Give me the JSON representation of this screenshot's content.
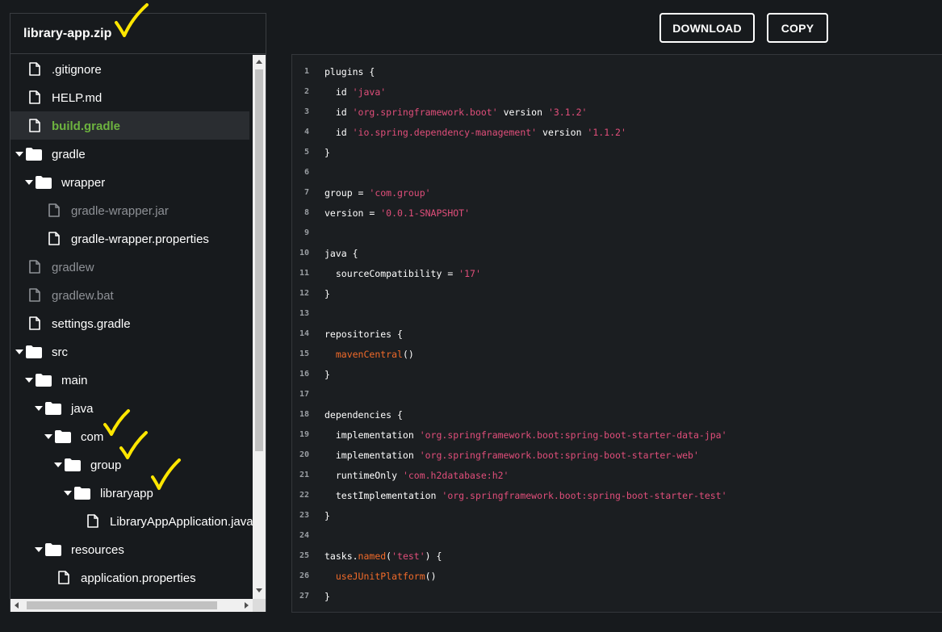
{
  "colors": {
    "background": "#171a1d",
    "selected_file": "#6db33f",
    "string_token": "#e04e7a",
    "function_token": "#f26b2a",
    "check_mark": "#ffe600",
    "dimmed_file": "#8e9196"
  },
  "tree": {
    "archive_name": "library-app.zip",
    "items": [
      {
        "label": ".gitignore",
        "kind": "file",
        "depth": 0,
        "dim": false,
        "selected": false
      },
      {
        "label": "HELP.md",
        "kind": "file",
        "depth": 0,
        "dim": false,
        "selected": false
      },
      {
        "label": "build.gradle",
        "kind": "file",
        "depth": 0,
        "dim": false,
        "selected": true
      },
      {
        "label": "gradle",
        "kind": "folder",
        "depth": 0,
        "dim": false,
        "selected": false
      },
      {
        "label": "wrapper",
        "kind": "folder",
        "depth": 1,
        "dim": false,
        "selected": false
      },
      {
        "label": "gradle-wrapper.jar",
        "kind": "file",
        "depth": 2,
        "dim": true,
        "selected": false
      },
      {
        "label": "gradle-wrapper.properties",
        "kind": "file",
        "depth": 2,
        "dim": false,
        "selected": false
      },
      {
        "label": "gradlew",
        "kind": "file",
        "depth": 0,
        "dim": true,
        "selected": false
      },
      {
        "label": "gradlew.bat",
        "kind": "file",
        "depth": 0,
        "dim": true,
        "selected": false
      },
      {
        "label": "settings.gradle",
        "kind": "file",
        "depth": 0,
        "dim": false,
        "selected": false
      },
      {
        "label": "src",
        "kind": "folder",
        "depth": 0,
        "dim": false,
        "selected": false
      },
      {
        "label": "main",
        "kind": "folder",
        "depth": 1,
        "dim": false,
        "selected": false
      },
      {
        "label": "java",
        "kind": "folder",
        "depth": 2,
        "dim": false,
        "selected": false
      },
      {
        "label": "com",
        "kind": "folder",
        "depth": 3,
        "dim": false,
        "selected": false
      },
      {
        "label": "group",
        "kind": "folder",
        "depth": 4,
        "dim": false,
        "selected": false
      },
      {
        "label": "libraryapp",
        "kind": "folder",
        "depth": 5,
        "dim": false,
        "selected": false
      },
      {
        "label": "LibraryAppApplication.java",
        "kind": "file",
        "depth": 6,
        "dim": false,
        "selected": false
      },
      {
        "label": "resources",
        "kind": "folder",
        "depth": 2,
        "dim": false,
        "selected": false
      },
      {
        "label": "application.properties",
        "kind": "file",
        "depth": 3,
        "dim": false,
        "selected": false
      }
    ]
  },
  "toolbar": {
    "download_label": "DOWNLOAD",
    "copy_label": "COPY"
  },
  "code": {
    "lines": [
      [
        [
          "plugins {",
          "plain"
        ]
      ],
      [
        [
          "  id ",
          "plain"
        ],
        [
          "'java'",
          "str"
        ]
      ],
      [
        [
          "  id ",
          "plain"
        ],
        [
          "'org.springframework.boot'",
          "str"
        ],
        [
          " version ",
          "plain"
        ],
        [
          "'3.1.2'",
          "str"
        ]
      ],
      [
        [
          "  id ",
          "plain"
        ],
        [
          "'io.spring.dependency-management'",
          "str"
        ],
        [
          " version ",
          "plain"
        ],
        [
          "'1.1.2'",
          "str"
        ]
      ],
      [
        [
          "}",
          "plain"
        ]
      ],
      [],
      [
        [
          "group = ",
          "plain"
        ],
        [
          "'com.group'",
          "str"
        ]
      ],
      [
        [
          "version = ",
          "plain"
        ],
        [
          "'0.0.1-SNAPSHOT'",
          "str"
        ]
      ],
      [],
      [
        [
          "java {",
          "plain"
        ]
      ],
      [
        [
          "  sourceCompatibility = ",
          "plain"
        ],
        [
          "'17'",
          "str"
        ]
      ],
      [
        [
          "}",
          "plain"
        ]
      ],
      [],
      [
        [
          "repositories {",
          "plain"
        ]
      ],
      [
        [
          "  ",
          "plain"
        ],
        [
          "mavenCentral",
          "fn"
        ],
        [
          "()",
          "plain"
        ]
      ],
      [
        [
          "}",
          "plain"
        ]
      ],
      [],
      [
        [
          "dependencies {",
          "plain"
        ]
      ],
      [
        [
          "  implementation ",
          "plain"
        ],
        [
          "'org.springframework.boot:spring-boot-starter-data-jpa'",
          "str"
        ]
      ],
      [
        [
          "  implementation ",
          "plain"
        ],
        [
          "'org.springframework.boot:spring-boot-starter-web'",
          "str"
        ]
      ],
      [
        [
          "  runtimeOnly ",
          "plain"
        ],
        [
          "'com.h2database:h2'",
          "str"
        ]
      ],
      [
        [
          "  testImplementation ",
          "plain"
        ],
        [
          "'org.springframework.boot:spring-boot-starter-test'",
          "str"
        ]
      ],
      [
        [
          "}",
          "plain"
        ]
      ],
      [],
      [
        [
          "tasks.",
          "plain"
        ],
        [
          "named",
          "fn"
        ],
        [
          "(",
          "plain"
        ],
        [
          "'test'",
          "str"
        ],
        [
          ") {",
          "plain"
        ]
      ],
      [
        [
          "  ",
          "plain"
        ],
        [
          "useJUnitPlatform",
          "fn"
        ],
        [
          "()",
          "plain"
        ]
      ],
      [
        [
          "}",
          "plain"
        ]
      ]
    ]
  }
}
